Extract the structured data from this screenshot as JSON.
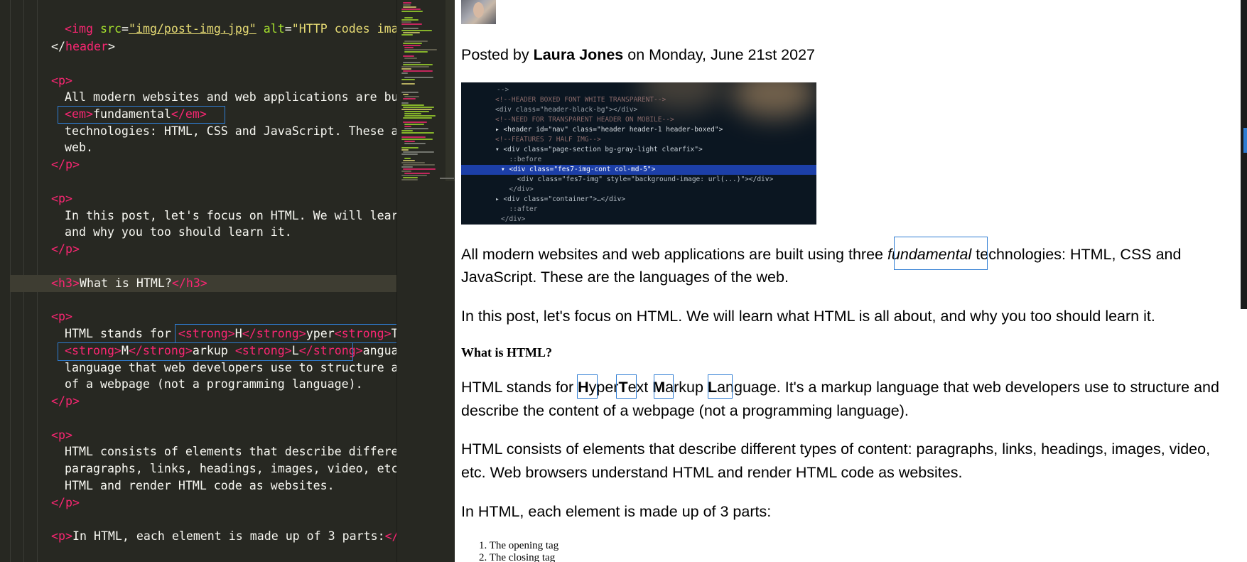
{
  "editor": {
    "lines": {
      "l_img_pre": "<",
      "l_img_tag": "img",
      "l_img_sp": " ",
      "l_img_attr1": "src",
      "l_img_eq1": "=",
      "l_img_src": "\"img/post-img.jpg\"",
      "l_img_attr2": " alt",
      "l_img_eq2": "=",
      "l_img_alt": "\"HTTP codes image",
      "l_header_close_a": "</",
      "l_header_close_tag": "header",
      "l_header_close_b": ">",
      "l_p1_open": "<p>",
      "l_p1_text1": "All modern websites and web applications are buil",
      "l_p1_em_open": "<em>",
      "l_p1_em_text": "fundamental",
      "l_p1_em_close": "</em>",
      "l_p1_text2": "technologies: HTML, CSS and JavaScript. These are",
      "l_p1_text3": "web.",
      "l_p1_close": "</p>",
      "l_p2_open": "<p>",
      "l_p2_text1": "In this post, let's focus on HTML. We will learn",
      "l_p2_text2": "and why you too should learn it.",
      "l_p2_close": "</p>",
      "l_h3_open": "<h3>",
      "l_h3_text": "What is HTML?",
      "l_h3_close": "</h3>",
      "l_p3_open": "<p>",
      "l_p3_a1": "HTML stands for ",
      "l_p3_s1o": "<strong>",
      "l_p3_H": "H",
      "l_p3_s1c": "</strong>",
      "l_p3_yper": "yper",
      "l_p3_s2o": "<strong>",
      "l_p3_T": "T",
      "l_p3_s2c": "</",
      "l_p3_s3o": "<strong>",
      "l_p3_M": "M",
      "l_p3_s3c": "</strong>",
      "l_p3_arkup": "arkup ",
      "l_p3_s4o": "<strong>",
      "l_p3_L": "L",
      "l_p3_s4c": "</strong>",
      "l_p3_anguage": "anguage",
      "l_p3_text3": "language that web developers use to structure and",
      "l_p3_text4": "of a webpage (not a programming language).",
      "l_p3_close": "</p>",
      "l_p4_open": "<p>",
      "l_p4_text1": "HTML consists of elements that describe different",
      "l_p4_text2": "paragraphs, links, headings, images, video, etc.",
      "l_p4_text3": "HTML and render HTML code as websites.",
      "l_p4_close": "</p>",
      "l_p5_open": "<p>",
      "l_p5_text": "In HTML, each element is made up of 3 parts:",
      "l_p5_close": "</p"
    }
  },
  "browser": {
    "byline": {
      "prefix": "Posted by ",
      "author": "Laura Jones",
      "suffix": " on Monday, June 21st 2027"
    },
    "image_code": [
      "-->",
      "<!--HEADER BOXED FONT WHITE TRANSPARENT-->",
      "<div class=\"header-black-bg\"></div>",
      "<!--NEED FOR TRANSPARENT HEADER ON MOBILE-->",
      "▸ <header id=\"nav\" class=\"header header-1 header-boxed\">",
      "<!--FEATURES 7 HALF IMG-->",
      "▾ <div class=\"page-section bg-gray-light clearfix\">",
      "  ::before",
      "▾ <div class=\"fes7-img-cont col-md-5\">",
      "    <div class=\"fes7-img\" style=\"background-image: url(...)\"></div>",
      "  </div>",
      "▸ <div class=\"container\">…</div>",
      "  ::after",
      "</div>"
    ],
    "p1": {
      "a": "All modern websites and web applications are built using three ",
      "em": "fundamental",
      "b": " technologies: HTML, CSS and",
      "c": "JavaScript. These are the languages of the web."
    },
    "p2": "In this post, let's focus on HTML. We will learn what HTML is all about, and why you too should learn it.",
    "h3": "What is HTML?",
    "p3": {
      "a": "HTML stands for ",
      "H": "H",
      "yper": "yper",
      "T": "T",
      "ext": "ext ",
      "M": "M",
      "arkup": "arkup ",
      "L": "L",
      "anguage": "anguage. It's a markup language that web developers use to structure and",
      "line2": "describe the content of a webpage (not a programming language)."
    },
    "p4": {
      "line1": "HTML consists of elements that describe different types of content: paragraphs, links, headings, images, video,",
      "line2": "etc. Web browsers understand HTML and render HTML code as websites."
    },
    "p5": "In HTML, each element is made up of 3 parts:",
    "list": [
      "1. The opening tag",
      "2. The closing tag"
    ]
  },
  "colors": {
    "editor_bg": "#272822",
    "tag": "#f92672",
    "attr": "#a6e22e",
    "string": "#e6db74",
    "selection": "#2f7dd3"
  }
}
